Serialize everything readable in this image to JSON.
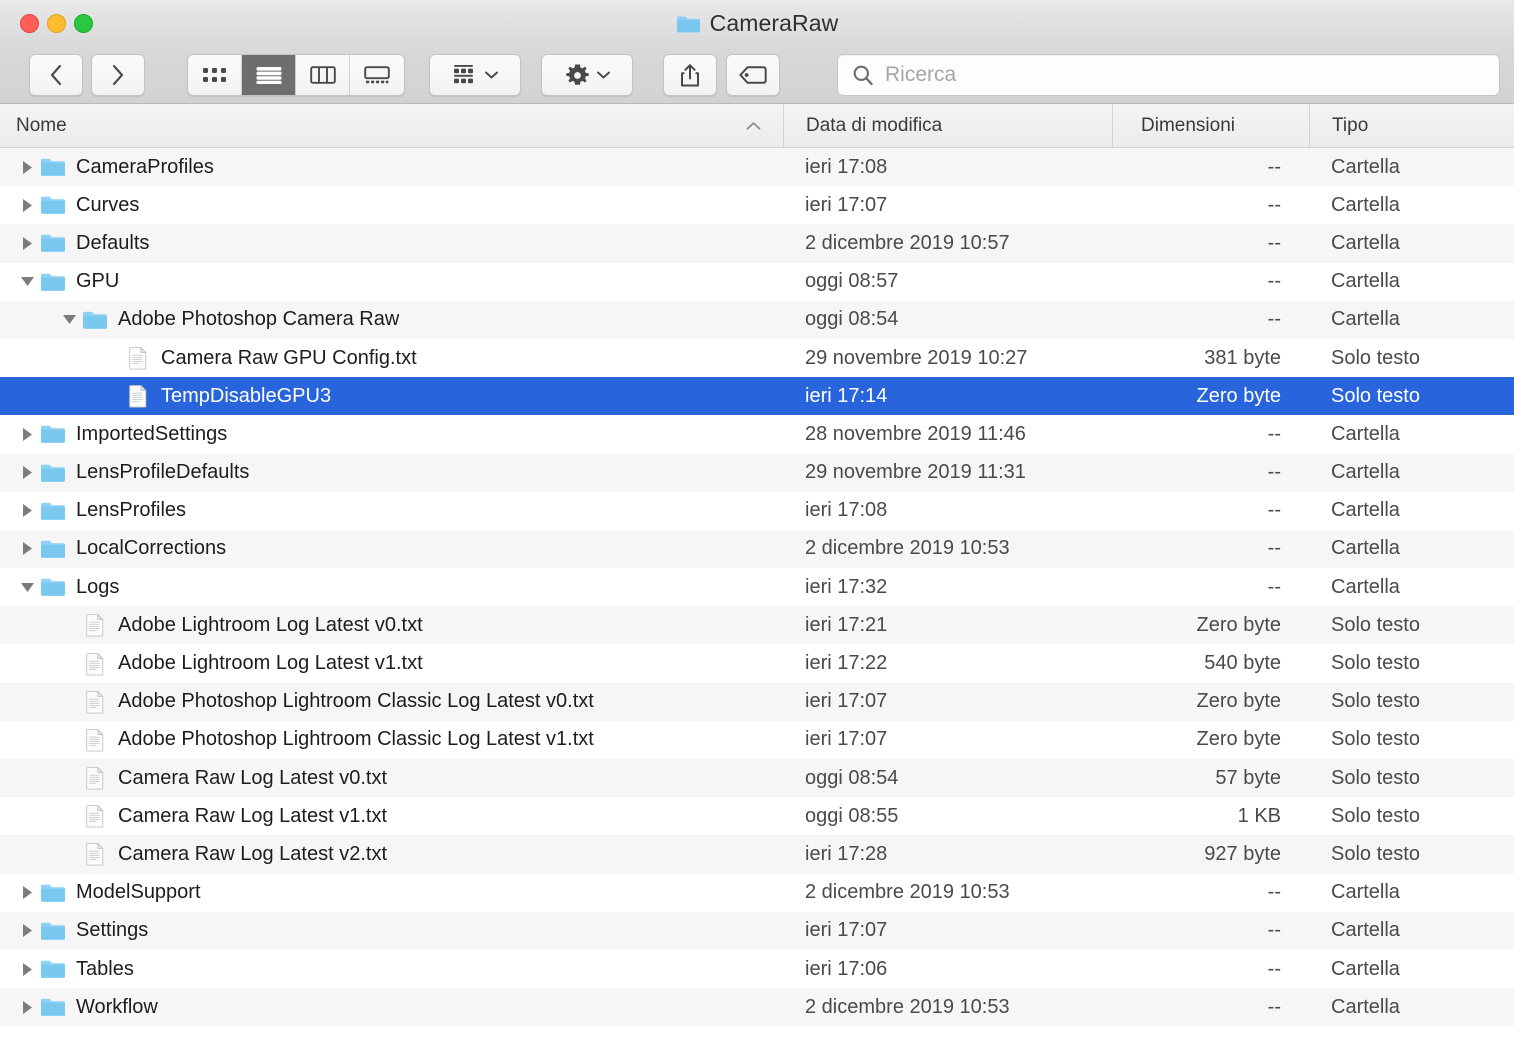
{
  "window": {
    "title": "CameraRaw",
    "traffic_lights": [
      "close",
      "minimize",
      "zoom"
    ]
  },
  "toolbar": {
    "back_label": "Indietro",
    "forward_label": "Avanti",
    "view_icon_label": "Vista icone",
    "view_list_label": "Vista elenco",
    "view_column_label": "Vista colonne",
    "view_gallery_label": "Vista galleria",
    "arrange_label": "Disponi",
    "action_label": "Azione",
    "share_label": "Condividi",
    "tags_label": "Tag",
    "active_view": "list"
  },
  "search": {
    "placeholder": "Ricerca",
    "value": ""
  },
  "columns": {
    "name": "Nome",
    "date": "Data di modifica",
    "size": "Dimensioni",
    "type": "Tipo",
    "sort_column": "name",
    "sort_direction": "ascending"
  },
  "colors": {
    "selection": "#2864dc",
    "folder": "#79c8f0",
    "row_alt": "#f6f6f6"
  },
  "rows": [
    {
      "name": "CameraProfiles",
      "date": "ieri 17:08",
      "size": "--",
      "type": "Cartella",
      "kind": "folder",
      "indent": 0,
      "twisty": "collapsed",
      "selected": false
    },
    {
      "name": "Curves",
      "date": "ieri 17:07",
      "size": "--",
      "type": "Cartella",
      "kind": "folder",
      "indent": 0,
      "twisty": "collapsed",
      "selected": false
    },
    {
      "name": "Defaults",
      "date": "2 dicembre 2019 10:57",
      "size": "--",
      "type": "Cartella",
      "kind": "folder",
      "indent": 0,
      "twisty": "collapsed",
      "selected": false
    },
    {
      "name": "GPU",
      "date": "oggi 08:57",
      "size": "--",
      "type": "Cartella",
      "kind": "folder",
      "indent": 0,
      "twisty": "expanded",
      "selected": false
    },
    {
      "name": "Adobe Photoshop Camera Raw",
      "date": "oggi 08:54",
      "size": "--",
      "type": "Cartella",
      "kind": "folder",
      "indent": 1,
      "twisty": "expanded",
      "selected": false
    },
    {
      "name": "Camera Raw GPU Config.txt",
      "date": "29 novembre 2019 10:27",
      "size": "381 byte",
      "type": "Solo testo",
      "kind": "file",
      "indent": 2,
      "twisty": "none",
      "selected": false
    },
    {
      "name": "TempDisableGPU3",
      "date": "ieri 17:14",
      "size": "Zero byte",
      "type": "Solo testo",
      "kind": "file",
      "indent": 2,
      "twisty": "none",
      "selected": true
    },
    {
      "name": "ImportedSettings",
      "date": "28 novembre 2019 11:46",
      "size": "--",
      "type": "Cartella",
      "kind": "folder",
      "indent": 0,
      "twisty": "collapsed",
      "selected": false
    },
    {
      "name": "LensProfileDefaults",
      "date": "29 novembre 2019 11:31",
      "size": "--",
      "type": "Cartella",
      "kind": "folder",
      "indent": 0,
      "twisty": "collapsed",
      "selected": false
    },
    {
      "name": "LensProfiles",
      "date": "ieri 17:08",
      "size": "--",
      "type": "Cartella",
      "kind": "folder",
      "indent": 0,
      "twisty": "collapsed",
      "selected": false
    },
    {
      "name": "LocalCorrections",
      "date": "2 dicembre 2019 10:53",
      "size": "--",
      "type": "Cartella",
      "kind": "folder",
      "indent": 0,
      "twisty": "collapsed",
      "selected": false
    },
    {
      "name": "Logs",
      "date": "ieri 17:32",
      "size": "--",
      "type": "Cartella",
      "kind": "folder",
      "indent": 0,
      "twisty": "expanded",
      "selected": false
    },
    {
      "name": "Adobe Lightroom Log Latest v0.txt",
      "date": "ieri 17:21",
      "size": "Zero byte",
      "type": "Solo testo",
      "kind": "file",
      "indent": 1,
      "twisty": "none",
      "selected": false
    },
    {
      "name": "Adobe Lightroom Log Latest v1.txt",
      "date": "ieri 17:22",
      "size": "540 byte",
      "type": "Solo testo",
      "kind": "file",
      "indent": 1,
      "twisty": "none",
      "selected": false
    },
    {
      "name": "Adobe Photoshop Lightroom Classic Log Latest v0.txt",
      "date": "ieri 17:07",
      "size": "Zero byte",
      "type": "Solo testo",
      "kind": "file",
      "indent": 1,
      "twisty": "none",
      "selected": false
    },
    {
      "name": "Adobe Photoshop Lightroom Classic Log Latest v1.txt",
      "date": "ieri 17:07",
      "size": "Zero byte",
      "type": "Solo testo",
      "kind": "file",
      "indent": 1,
      "twisty": "none",
      "selected": false
    },
    {
      "name": "Camera Raw Log Latest v0.txt",
      "date": "oggi 08:54",
      "size": "57 byte",
      "type": "Solo testo",
      "kind": "file",
      "indent": 1,
      "twisty": "none",
      "selected": false
    },
    {
      "name": "Camera Raw Log Latest v1.txt",
      "date": "oggi 08:55",
      "size": "1 KB",
      "type": "Solo testo",
      "kind": "file",
      "indent": 1,
      "twisty": "none",
      "selected": false
    },
    {
      "name": "Camera Raw Log Latest v2.txt",
      "date": "ieri 17:28",
      "size": "927 byte",
      "type": "Solo testo",
      "kind": "file",
      "indent": 1,
      "twisty": "none",
      "selected": false
    },
    {
      "name": "ModelSupport",
      "date": "2 dicembre 2019 10:53",
      "size": "--",
      "type": "Cartella",
      "kind": "folder",
      "indent": 0,
      "twisty": "collapsed",
      "selected": false
    },
    {
      "name": "Settings",
      "date": "ieri 17:07",
      "size": "--",
      "type": "Cartella",
      "kind": "folder",
      "indent": 0,
      "twisty": "collapsed",
      "selected": false
    },
    {
      "name": "Tables",
      "date": "ieri 17:06",
      "size": "--",
      "type": "Cartella",
      "kind": "folder",
      "indent": 0,
      "twisty": "collapsed",
      "selected": false
    },
    {
      "name": "Workflow",
      "date": "2 dicembre 2019 10:53",
      "size": "--",
      "type": "Cartella",
      "kind": "folder",
      "indent": 0,
      "twisty": "collapsed",
      "selected": false
    }
  ]
}
